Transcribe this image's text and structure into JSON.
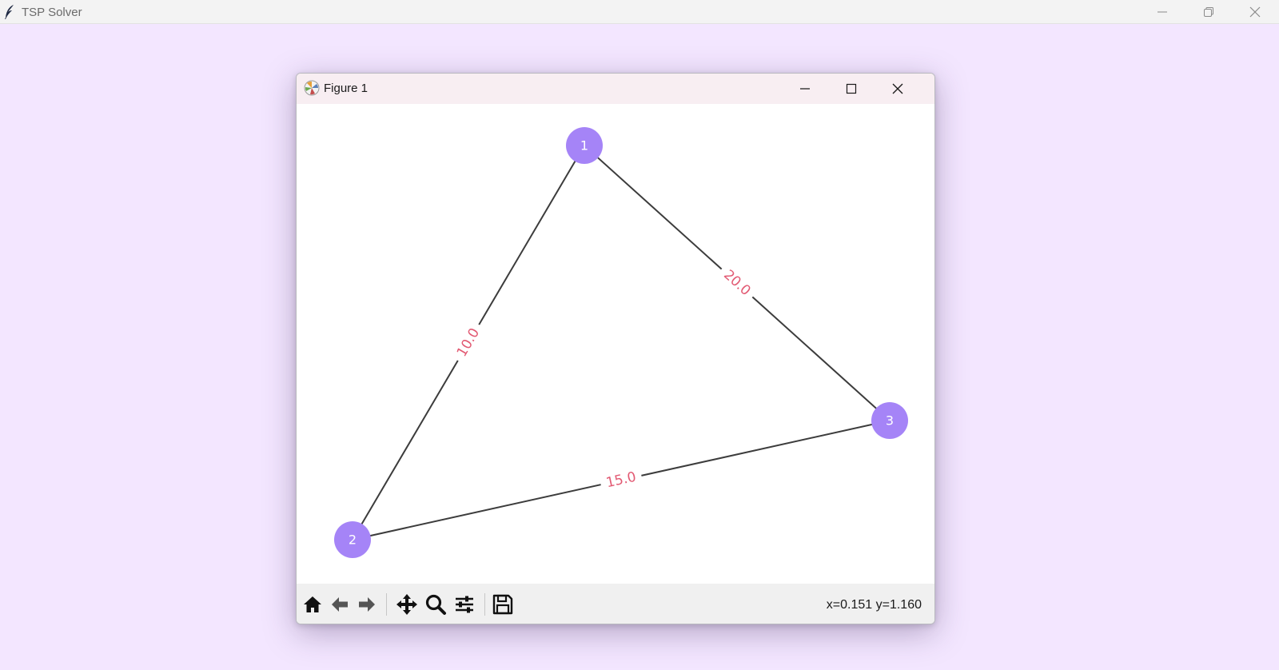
{
  "app": {
    "title": "TSP Solver"
  },
  "figure_window": {
    "title": "Figure 1",
    "coords_readout": "x=0.151 y=1.160",
    "toolbar": [
      {
        "name": "home-icon",
        "label": "Home"
      },
      {
        "name": "back-icon",
        "label": "Back"
      },
      {
        "name": "forward-icon",
        "label": "Forward"
      },
      {
        "name": "pan-icon",
        "label": "Pan"
      },
      {
        "name": "zoom-icon",
        "label": "Zoom"
      },
      {
        "name": "configure-subplots-icon",
        "label": "Configure subplots"
      },
      {
        "name": "save-icon",
        "label": "Save"
      }
    ]
  },
  "graph": {
    "node_color": "#a584f7",
    "edge_color": "#3c3c3c",
    "edge_label_color": "#e25a73",
    "nodes": [
      {
        "id": "1",
        "label": "1"
      },
      {
        "id": "2",
        "label": "2"
      },
      {
        "id": "3",
        "label": "3"
      }
    ],
    "edges": [
      {
        "from": "1",
        "to": "2",
        "weight_label": "10.0"
      },
      {
        "from": "1",
        "to": "3",
        "weight_label": "20.0"
      },
      {
        "from": "2",
        "to": "3",
        "weight_label": "15.0"
      }
    ]
  }
}
